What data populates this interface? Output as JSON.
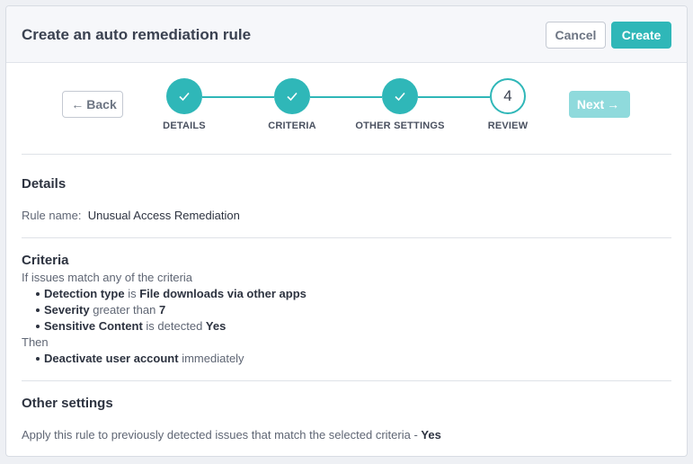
{
  "header": {
    "title": "Create an auto remediation rule",
    "cancel_label": "Cancel",
    "create_label": "Create"
  },
  "nav": {
    "back_label": "Back",
    "next_label": "Next",
    "back_arrow": "←",
    "next_arrow": "→"
  },
  "steps": [
    {
      "label": "DETAILS",
      "state": "done"
    },
    {
      "label": "CRITERIA",
      "state": "done"
    },
    {
      "label": "OTHER SETTINGS",
      "state": "done"
    },
    {
      "label": "REVIEW",
      "state": "current",
      "number": "4"
    }
  ],
  "details": {
    "title": "Details",
    "rule_name_label": "Rule name:",
    "rule_name_value": "Unusual Access Remediation"
  },
  "criteria": {
    "title": "Criteria",
    "intro": "If issues match any of the criteria",
    "items": [
      {
        "field": "Detection type",
        "op": "is",
        "value": "File downloads via other apps"
      },
      {
        "field": "Severity",
        "op": "greater than",
        "value": "7"
      },
      {
        "field": "Sensitive Content",
        "op": "is detected",
        "value": "Yes"
      }
    ],
    "then_label": "Then",
    "actions": [
      {
        "action": "Deactivate user account",
        "timing": "immediately"
      }
    ]
  },
  "other_settings": {
    "title": "Other settings",
    "apply_text": "Apply this rule to previously detected issues that match the selected criteria -",
    "apply_value": "Yes"
  },
  "colors": {
    "accent": "#2fb7b8",
    "accent_disabled": "#8fdadc"
  }
}
